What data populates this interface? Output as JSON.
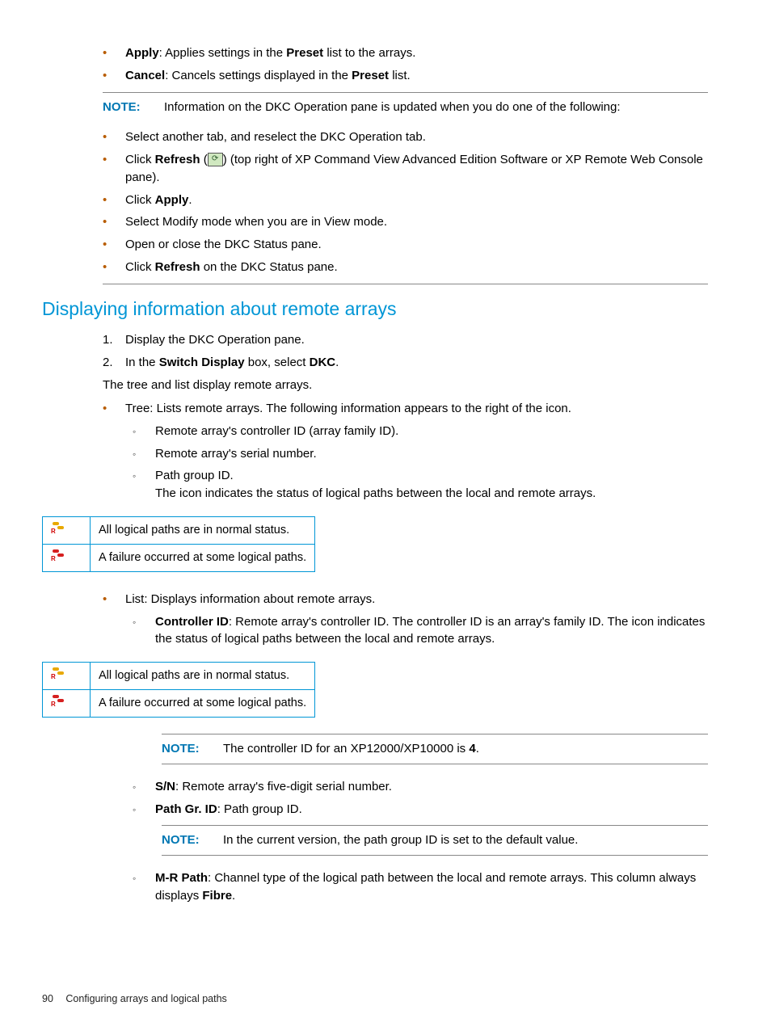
{
  "top_bullets": [
    {
      "label": "Apply",
      "rest": ": Applies settings in the ",
      "label2": "Preset",
      "rest2": " list to the arrays."
    },
    {
      "label": "Cancel",
      "rest": ": Cancels settings displayed in the ",
      "label2": "Preset",
      "rest2": " list."
    }
  ],
  "note1": {
    "label": "NOTE:",
    "text": "Information on the DKC Operation pane is updated when you do one of the following:"
  },
  "note1_bullets": {
    "b1": "Select another tab, and reselect the DKC Operation tab.",
    "b2_pre": "Click ",
    "b2_bold": "Refresh",
    "b2_mid": " (",
    "b2_post": ") (top right of XP Command View Advanced Edition Software or XP Remote Web Console pane).",
    "b3_pre": "Click ",
    "b3_bold": "Apply",
    "b3_post": ".",
    "b4": "Select Modify mode when you are in View mode.",
    "b5": "Open or close the DKC Status pane.",
    "b6_pre": "Click ",
    "b6_bold": "Refresh",
    "b6_post": " on the DKC Status pane."
  },
  "h2": "Displaying information about remote arrays",
  "steps": {
    "s1": "Display the DKC Operation pane.",
    "s2_pre": "In the ",
    "s2_b1": "Switch Display",
    "s2_mid": " box, select ",
    "s2_b2": "DKC",
    "s2_post": "."
  },
  "after_steps": "The tree and list display remote arrays.",
  "tree_intro": "Tree: Lists remote arrays. The following information appears to the right of the icon.",
  "tree_sub": {
    "a": "Remote array's controller ID (array family ID).",
    "b": "Remote array's serial number.",
    "c": "Path group ID.",
    "c_more": "The icon indicates the status of logical paths between the local and remote arrays."
  },
  "status_table": {
    "r1": "All logical paths are in normal status.",
    "r2": "A failure occurred at some logical paths."
  },
  "list_intro": "List: Displays information about remote arrays.",
  "list_sub": {
    "ctrl_b": "Controller ID",
    "ctrl_t": ": Remote array's controller ID. The controller ID is an array's family ID. The icon indicates the status of logical paths between the local and remote arrays."
  },
  "note2": {
    "label": "NOTE:",
    "text_pre": "The controller ID for an XP12000/XP10000 is ",
    "text_b": "4",
    "text_post": "."
  },
  "sn": {
    "b": "S/N",
    "t": ": Remote array's five-digit serial number."
  },
  "pg": {
    "b": "Path Gr. ID",
    "t": ": Path group ID."
  },
  "note3": {
    "label": "NOTE:",
    "text": "In the current version, the path group ID is set to the default value."
  },
  "mr": {
    "b": "M-R Path",
    "t1": ": Channel type of the logical path between the local and remote arrays. This column always displays ",
    "b2": "Fibre",
    "t2": "."
  },
  "footer": {
    "page": "90",
    "title": "Configuring arrays and logical paths"
  }
}
